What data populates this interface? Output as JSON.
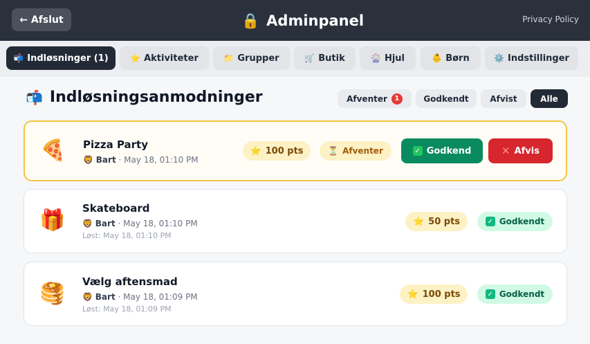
{
  "header": {
    "back_label": "← Afslut",
    "title_icon": "lock-icon",
    "title": "Adminpanel",
    "privacy_label": "Privacy Policy"
  },
  "tabs": [
    {
      "icon": "📬",
      "label": "Indløsninger (1)",
      "active": true
    },
    {
      "icon": "⭐",
      "label": "Aktiviteter"
    },
    {
      "icon": "📁",
      "label": "Grupper"
    },
    {
      "icon": "🛒",
      "label": "Butik"
    },
    {
      "icon": "🎡",
      "label": "Hjul"
    },
    {
      "icon": "👶",
      "label": "Børn"
    },
    {
      "icon": "⚙️",
      "label": "Indstillinger"
    }
  ],
  "section": {
    "icon": "📬",
    "title": "Indløsningsanmodninger"
  },
  "filters": {
    "pending_label": "Afventer",
    "pending_count": "1",
    "approved_label": "Godkendt",
    "rejected_label": "Afvist",
    "all_label": "Alle"
  },
  "requests": [
    {
      "icon": "🍕",
      "title": "Pizza Party",
      "child_icon": "🦁",
      "child": "Bart",
      "date": "· May 18, 01:10 PM",
      "points": "100 pts",
      "status": "Afventer",
      "approve_label": "Godkend",
      "reject_label": "Afvis"
    },
    {
      "icon": "🎁",
      "title": "Skateboard",
      "child_icon": "🦁",
      "child": "Bart",
      "date": "· May 18, 01:10 PM",
      "resolved": "Løst: May 18, 01:10 PM",
      "points": "50 pts",
      "status": "Godkendt"
    },
    {
      "icon": "🥞",
      "title": "Vælg aftensmad",
      "child_icon": "🦁",
      "child": "Bart",
      "date": "· May 18, 01:09 PM",
      "resolved": "Løst: May 18, 01:09 PM",
      "points": "100 pts",
      "status": "Godkendt"
    }
  ],
  "colors": {
    "header_bg": "#2a313d",
    "approve": "#0a8b5f",
    "reject": "#d7262e",
    "pending_border": "#f4c542"
  }
}
